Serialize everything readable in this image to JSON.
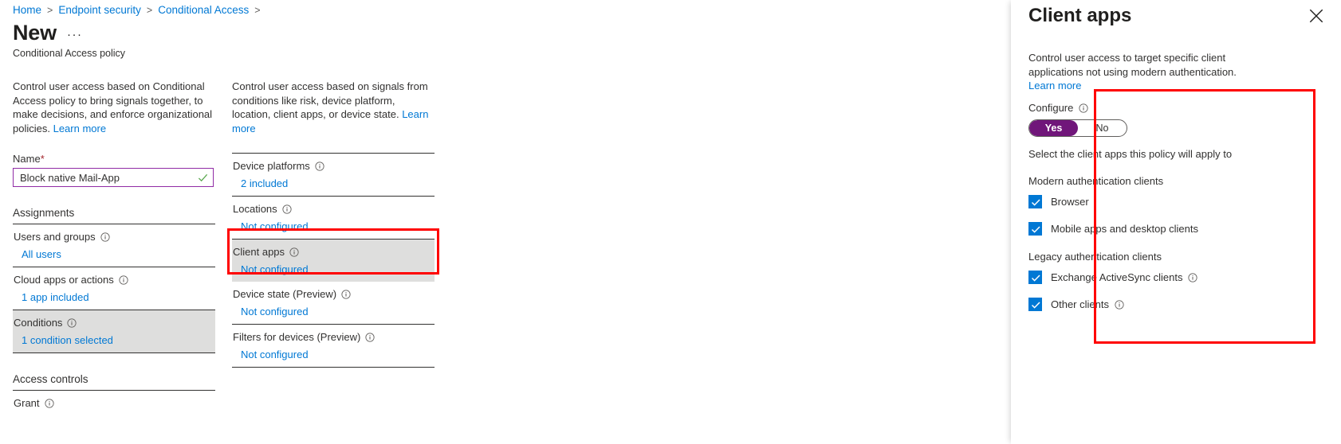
{
  "breadcrumb": {
    "items": [
      {
        "label": "Home"
      },
      {
        "label": "Endpoint security"
      },
      {
        "label": "Conditional Access"
      }
    ],
    "separator": ">"
  },
  "header": {
    "title": "New",
    "ellipsis": "···",
    "subtitle": "Conditional Access policy"
  },
  "left_column": {
    "description": "Control user access based on Conditional Access policy to bring signals together, to make decisions, and enforce organizational policies.",
    "learn_more": "Learn more",
    "name_label": "Name",
    "required_marker": "*",
    "name_value": "Block native Mail-App",
    "assignments_heading": "Assignments",
    "rows": [
      {
        "title": "Users and groups",
        "value": "All users",
        "selected": false
      },
      {
        "title": "Cloud apps or actions",
        "value": "1 app included",
        "selected": false
      },
      {
        "title": "Conditions",
        "value": "1 condition selected",
        "selected": true
      }
    ],
    "access_controls_heading": "Access controls",
    "grant_label": "Grant"
  },
  "mid_column": {
    "description": "Control user access based on signals from conditions like risk, device platform, location, client apps, or device state.",
    "learn_more": "Learn more",
    "rows": [
      {
        "title": "Device platforms",
        "value": "2 included",
        "selected": false
      },
      {
        "title": "Locations",
        "value": "Not configured",
        "selected": false
      },
      {
        "title": "Client apps",
        "value": "Not configured",
        "selected": true
      },
      {
        "title": "Device state (Preview)",
        "value": "Not configured",
        "selected": false
      },
      {
        "title": "Filters for devices (Preview)",
        "value": "Not configured",
        "selected": false
      }
    ]
  },
  "panel": {
    "title": "Client apps",
    "close_label": "✕",
    "description": "Control user access to target specific client applications not using modern authentication.",
    "learn_more": "Learn more",
    "configure_label": "Configure",
    "toggle": {
      "yes_label": "Yes",
      "no_label": "No",
      "selected": "Yes"
    },
    "hint": "Select the client apps this policy will apply to",
    "groups": [
      {
        "heading": "Modern authentication clients",
        "items": [
          {
            "label": "Browser",
            "checked": true,
            "info": false
          },
          {
            "label": "Mobile apps and desktop clients",
            "checked": true,
            "info": false
          }
        ]
      },
      {
        "heading": "Legacy authentication clients",
        "items": [
          {
            "label": "Exchange ActiveSync clients",
            "checked": true,
            "info": true
          },
          {
            "label": "Other clients",
            "checked": true,
            "info": true
          }
        ]
      }
    ]
  },
  "colors": {
    "link": "#0078d4",
    "annotation": "#ff0000",
    "toggle_on": "#70167a",
    "checkbox": "#0078d4",
    "input_border": "#902ba5",
    "selected_row": "#dededd"
  }
}
